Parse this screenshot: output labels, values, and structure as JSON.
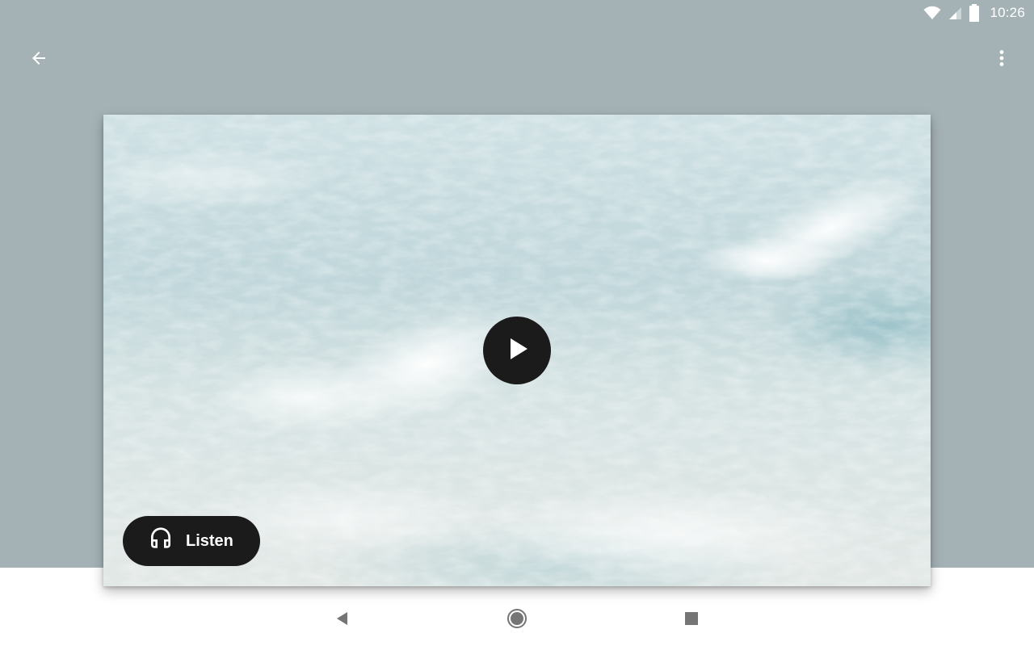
{
  "status_bar": {
    "time": "10:26",
    "icons": [
      "wifi-icon",
      "cellular-signal-icon",
      "battery-icon"
    ]
  },
  "app_bar": {
    "back_icon": "arrow-back-icon",
    "overflow_icon": "more-vert-icon"
  },
  "media": {
    "image": "ocean-wave-photo",
    "play_icon": "play-icon",
    "listen": {
      "label": "Listen",
      "icon": "headphones-icon"
    }
  },
  "nav_bar": {
    "buttons": [
      "back-triangle-icon",
      "home-circle-icon",
      "recents-square-icon"
    ]
  },
  "colors": {
    "backdrop": "#a4b2b6",
    "button_bg": "#1b1b1b",
    "icon_white": "#ffffff",
    "nav_icon": "#757575"
  }
}
